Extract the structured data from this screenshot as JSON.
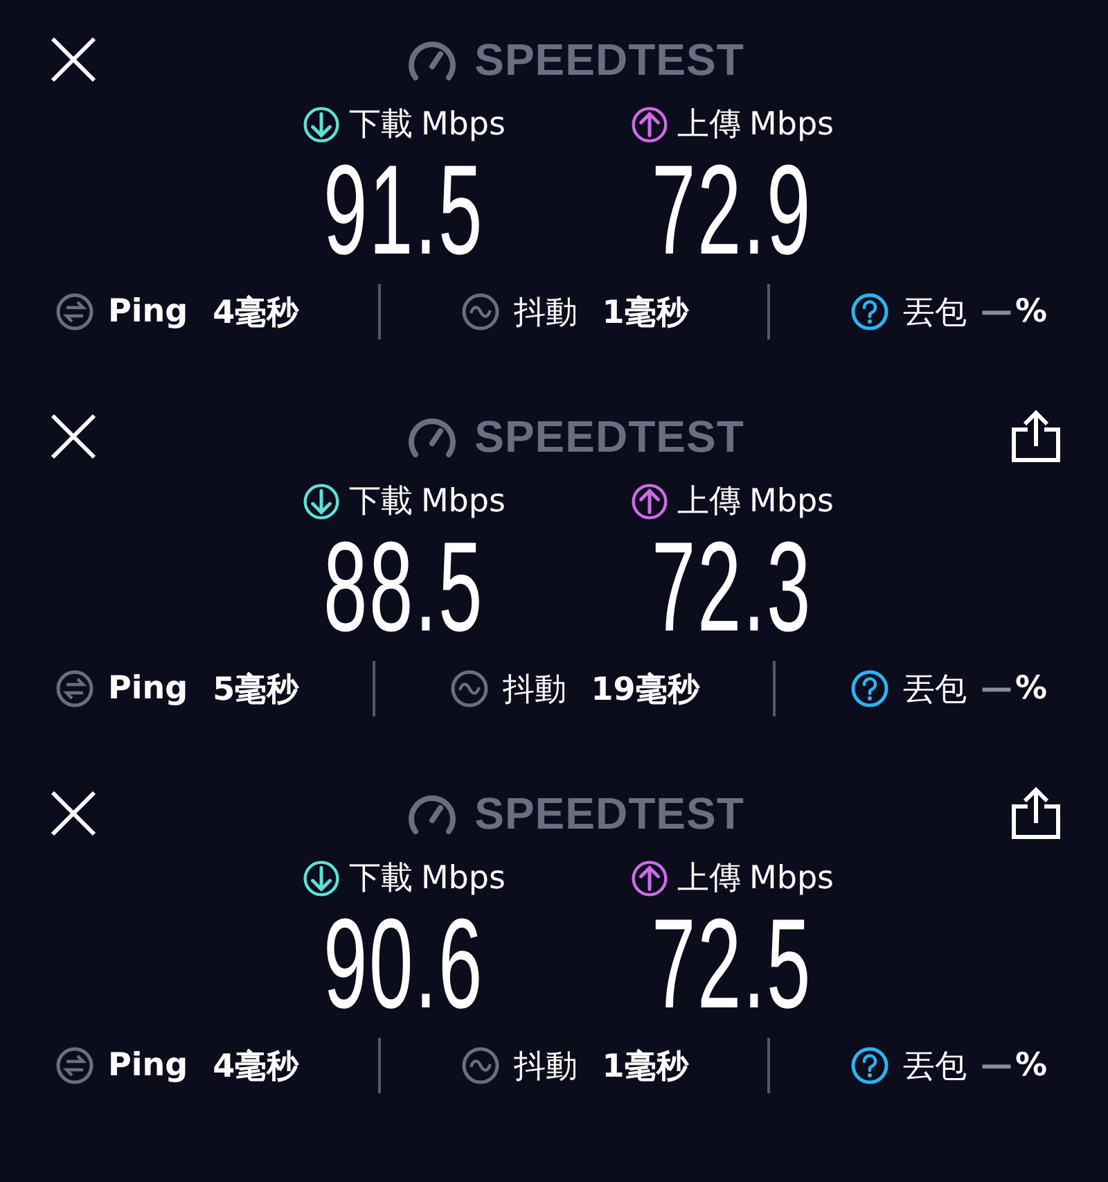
{
  "results": [
    {
      "share": false,
      "brand": "SPEEDTEST",
      "download": {
        "label": "下載",
        "unit": "Mbps",
        "value": "91.5"
      },
      "upload": {
        "label": "上傳",
        "unit": "Mbps",
        "value": "72.9"
      },
      "ping": {
        "label": "Ping",
        "value": "4毫秒"
      },
      "jitter": {
        "label": "抖動",
        "value": "1毫秒"
      },
      "loss": {
        "label": "丟包",
        "value": "—",
        "unit": "%"
      }
    },
    {
      "share": true,
      "brand": "SPEEDTEST",
      "download": {
        "label": "下載",
        "unit": "Mbps",
        "value": "88.5"
      },
      "upload": {
        "label": "上傳",
        "unit": "Mbps",
        "value": "72.3"
      },
      "ping": {
        "label": "Ping",
        "value": "5毫秒"
      },
      "jitter": {
        "label": "抖動",
        "value": "19毫秒"
      },
      "loss": {
        "label": "丟包",
        "value": "—",
        "unit": "%"
      }
    },
    {
      "share": true,
      "brand": "SPEEDTEST",
      "download": {
        "label": "下載",
        "unit": "Mbps",
        "value": "90.6"
      },
      "upload": {
        "label": "上傳",
        "unit": "Mbps",
        "value": "72.5"
      },
      "ping": {
        "label": "Ping",
        "value": "4毫秒"
      },
      "jitter": {
        "label": "抖動",
        "value": "1毫秒"
      },
      "loss": {
        "label": "丟包",
        "value": "—",
        "unit": "%"
      }
    }
  ]
}
